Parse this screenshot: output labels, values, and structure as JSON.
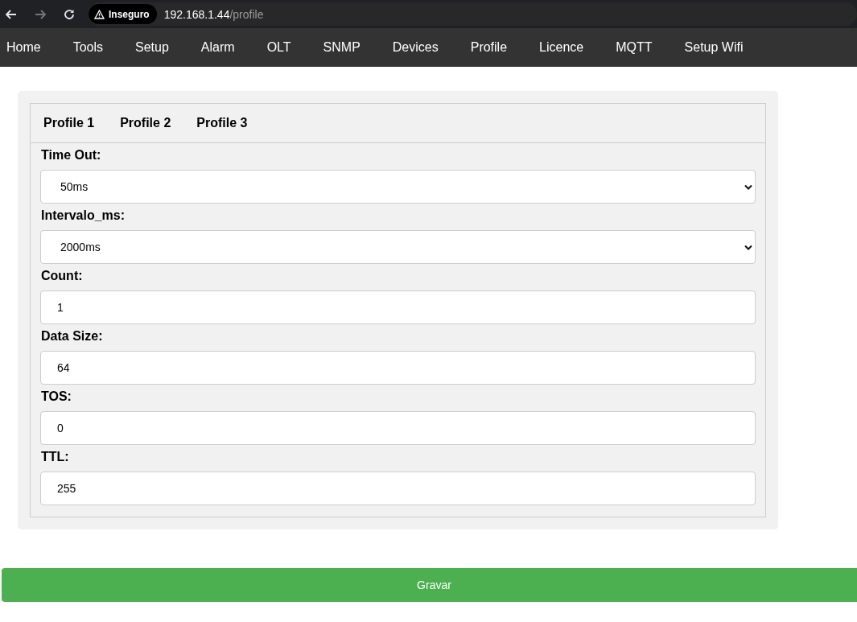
{
  "browser": {
    "security_label": "Inseguro",
    "url_host": "192.168.1.44",
    "url_path": "/profile"
  },
  "nav": [
    "Home",
    "Tools",
    "Setup",
    "Alarm",
    "OLT",
    "SNMP",
    "Devices",
    "Profile",
    "Licence",
    "MQTT",
    "Setup Wifi"
  ],
  "tabs": [
    "Profile 1",
    "Profile 2",
    "Profile 3"
  ],
  "fields": [
    {
      "label": "Time Out:",
      "kind": "select",
      "value": "50ms"
    },
    {
      "label": "Intervalo_ms:",
      "kind": "select",
      "value": "2000ms"
    },
    {
      "label": "Count:",
      "kind": "input",
      "value": "1"
    },
    {
      "label": "Data Size:",
      "kind": "input",
      "value": "64"
    },
    {
      "label": "TOS:",
      "kind": "input",
      "value": "0"
    },
    {
      "label": "TTL:",
      "kind": "input",
      "value": "255"
    }
  ],
  "save_button": "Gravar"
}
